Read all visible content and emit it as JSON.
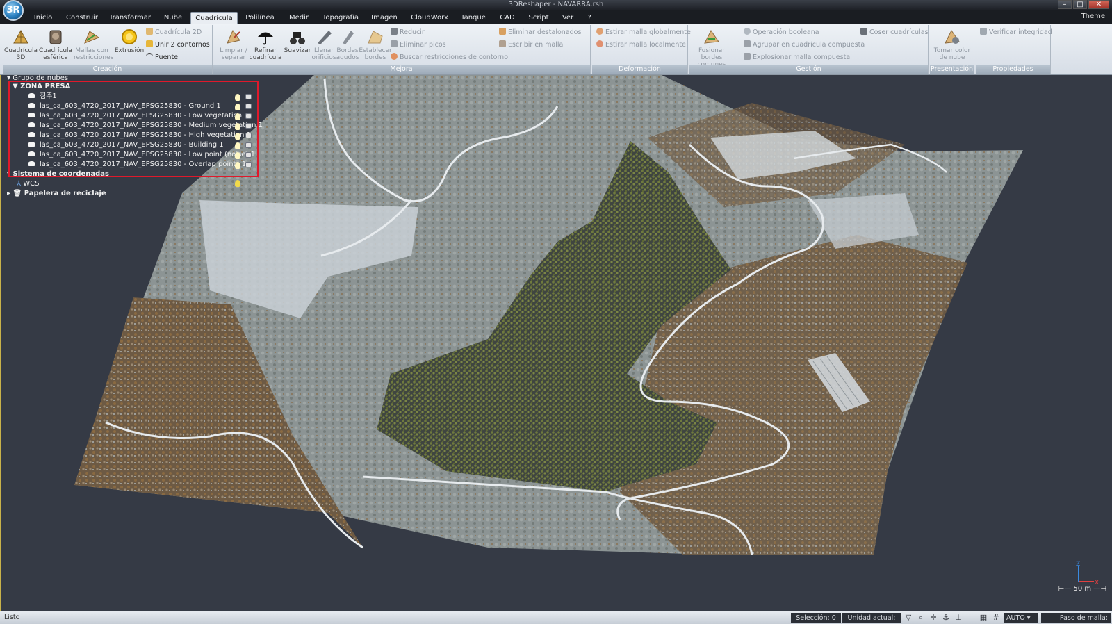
{
  "window": {
    "title": "3DReshaper - NAVARRA.rsh",
    "logo": "3R",
    "min": "–",
    "max": "□",
    "close": "✕"
  },
  "menu": {
    "tabs": [
      "Inicio",
      "Construir",
      "Transformar",
      "Nube",
      "Cuadrícula",
      "Polilínea",
      "Medir",
      "Topografía",
      "Imagen",
      "CloudWorx",
      "Tanque",
      "CAD",
      "Script",
      "Ver",
      "?"
    ],
    "active": "Cuadrícula",
    "theme": "Theme"
  },
  "ribbon": {
    "creacion": {
      "title": "Creación",
      "cuadricula3d": "Cuadrícula 3D",
      "esferica": "Cuadrícula esférica",
      "mallas": "Mallas con restricciones",
      "extrusion": "Extrusión",
      "cuadricula2d": "Cuadrícula 2D",
      "unir": "Unir 2 contornos",
      "puente": "Puente"
    },
    "mejora": {
      "title": "Mejora",
      "limpiar": "Limpiar / separar",
      "refinar": "Refinar cuadrícula",
      "suavizar": "Suavizar",
      "llenar": "Llenar orificios",
      "bordes": "Bordes agudos",
      "establecer": "Establecer bordes",
      "reducir": "Reducir",
      "eliminar_picos": "Eliminar picos",
      "buscar": "Buscar restricciones de contorno",
      "eliminar_desta": "Eliminar destalonados",
      "escribir": "Escribir en malla"
    },
    "deformacion": {
      "title": "Deformación",
      "global": "Estirar malla globalmente",
      "local": "Estirar malla localmente"
    },
    "gestion": {
      "title": "Gestión",
      "fusionar": "Fusionar bordes comunes",
      "booleana": "Operación booleana",
      "agrupar": "Agrupar en cuadrícula compuesta",
      "explosionar": "Explosionar malla compuesta",
      "coser": "Coser cuadrículas"
    },
    "presentacion": {
      "title": "Presentación",
      "tomar": "Tomar color de nube"
    },
    "propiedades": {
      "title": "Propiedades",
      "verificar": "Verificar integridad"
    }
  },
  "tree": {
    "group": "Grupo de nubes",
    "zone": "ZONA PRESA",
    "items": [
      "침주1",
      "las_ca_603_4720_2017_NAV_EPSG25830 - Ground 1",
      "las_ca_603_4720_2017_NAV_EPSG25830 - Low vegetation 1",
      "las_ca_603_4720_2017_NAV_EPSG25830 - Medium vegetation 1",
      "las_ca_603_4720_2017_NAV_EPSG25830 - High vegetation 1",
      "las_ca_603_4720_2017_NAV_EPSG25830 - Building 1",
      "las_ca_603_4720_2017_NAV_EPSG25830 - Low point (noise) 1",
      "las_ca_603_4720_2017_NAV_EPSG25830 - Overlap points 1"
    ],
    "coord": "Sistema de coordenadas",
    "wcs": "WCS",
    "trash": "Papelera de reciclaje"
  },
  "viewport": {
    "scale": "50 m",
    "axis_z": "Z",
    "axis_x": "X"
  },
  "status": {
    "left": "Listo",
    "seleccion": "Selección: 0",
    "unidad": "Unidad actual: m",
    "auto": "AUTO",
    "paso": "Paso de malla: AUTO"
  },
  "colors": {
    "highlight": "#e0192b",
    "accent": "#c9b24a"
  }
}
